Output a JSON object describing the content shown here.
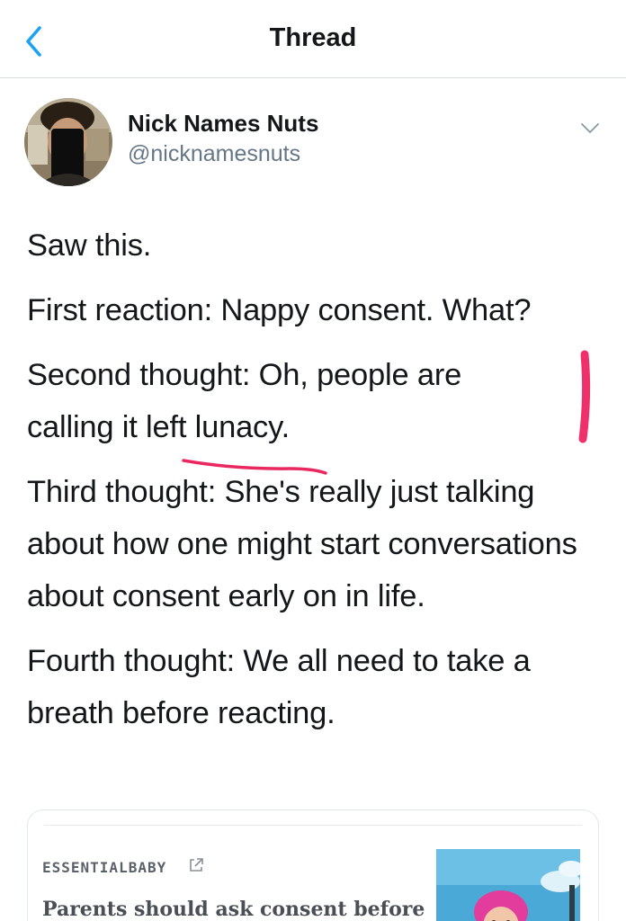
{
  "header": {
    "title": "Thread",
    "back_icon": "chevron-left-icon"
  },
  "author": {
    "name": "Nick Names Nuts",
    "handle": "@nicknamesnuts",
    "avatar_icon": "avatar-photo",
    "menu_icon": "chevron-down-icon"
  },
  "tweet": {
    "paragraphs": [
      "Saw this.",
      "First reaction: Nappy consent. What?",
      "Second thought: Oh, people are calling it left lunacy.",
      "Third thought: She's really just talking about how one might start conversations about consent early on in life.",
      "Fourth thought: We all need to take a breath before reacting."
    ]
  },
  "link_card": {
    "source": "ESSENTIALBABY",
    "external_icon": "external-link-icon",
    "headline": "Parents should ask consent before"
  },
  "colors": {
    "accent": "#1da1f2",
    "text_primary": "#14171a",
    "text_secondary": "#657786",
    "annotation_marker": "#f0306a",
    "divider": "#d8dde1"
  }
}
